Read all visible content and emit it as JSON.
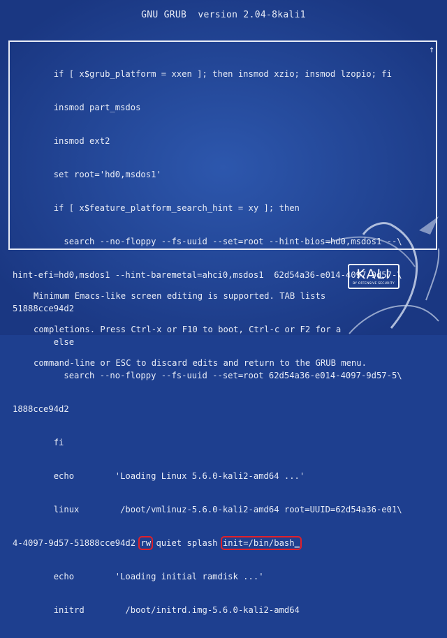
{
  "header": {
    "title": "GNU GRUB  version 2.04-8kali1"
  },
  "editor": {
    "scroll_indicator": "↑",
    "lines": [
      "        if [ x$grub_platform = xxen ]; then insmod xzio; insmod lzopio; fi",
      "        insmod part_msdos",
      "        insmod ext2",
      "        set root='hd0,msdos1'",
      "        if [ x$feature_platform_search_hint = xy ]; then",
      "          search --no-floppy --fs-uuid --set=root --hint-bios=hd0,msdos1 --\\",
      "hint-efi=hd0,msdos1 --hint-baremetal=ahci0,msdos1  62d54a36-e014-4097-9d57-\\",
      "51888cce94d2",
      "        else",
      "          search --no-floppy --fs-uuid --set=root 62d54a36-e014-4097-9d57-5\\",
      "1888cce94d2",
      "        fi",
      "        echo        'Loading Linux 5.6.0-kali2-amd64 ...'",
      "        linux        /boot/vmlinuz-5.6.0-kali2-amd64 root=UUID=62d54a36-e01\\"
    ],
    "kernel_line": {
      "prefix": "4-4097-9d57-51888cce94d2 ",
      "rw": "rw",
      "middle": " quiet splash ",
      "init": "init=/bin/bash",
      "cursor": "_"
    },
    "lines_after": [
      "        echo        'Loading initial ramdisk ...'",
      "        initrd        /boot/initrd.img-5.6.0-kali2-amd64"
    ],
    "highlight_color": "#e0202a"
  },
  "help": {
    "lines": [
      "Minimum Emacs-like screen editing is supported. TAB lists",
      "completions. Press Ctrl-x or F10 to boot, Ctrl-c or F2 for a",
      "command-line or ESC to discard edits and return to the GRUB menu."
    ]
  },
  "logo": {
    "word": "KALI",
    "tagline": "BY OFFENSIVE SECURITY"
  },
  "colors": {
    "background": "#1e3f8f",
    "text": "#e8ecf6"
  }
}
